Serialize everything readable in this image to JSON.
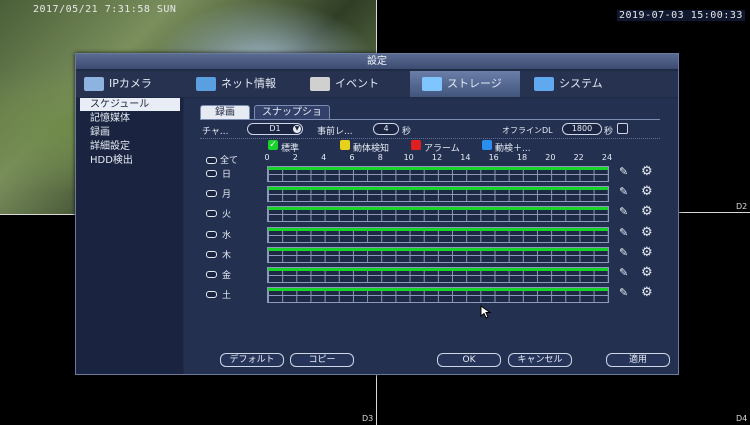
{
  "cameras": {
    "top_left_timestamp": "2017/05/21 7:31:58 SUN",
    "top_right_timestamp": "2019-07-03 15:00:33",
    "labels": [
      "D2",
      "D3",
      "D4"
    ]
  },
  "dialog": {
    "title": "設定",
    "main_tabs": [
      {
        "label": "IPカメラ",
        "icon": "ip-camera-icon",
        "color": "#8fb3e0"
      },
      {
        "label": "ネット情報",
        "icon": "network-icon",
        "color": "#5aa0e0"
      },
      {
        "label": "イベント",
        "icon": "event-icon",
        "color": "#d0d0d0"
      },
      {
        "label": "ストレージ",
        "icon": "storage-icon",
        "color": "#7fc6ff"
      },
      {
        "label": "システム",
        "icon": "system-icon",
        "color": "#60a8f0"
      }
    ],
    "active_main_tab": "ストレージ",
    "sidebar": [
      "スケジュール",
      "記憶媒体",
      "録画",
      "詳細設定",
      "HDD検出"
    ],
    "active_sidebar_item": "スケジュール",
    "sub_tabs": [
      "録画",
      "スナップショ"
    ],
    "active_sub_tab": "録画",
    "channel_label": "チャ...",
    "channel_value": "D1",
    "pre_record_label": "事前レ...",
    "pre_record_value": "4",
    "pre_record_unit": "秒",
    "offline_label": "オフラインDL",
    "offline_value": "1800",
    "offline_unit": "秒",
    "legend": [
      {
        "label": "標準",
        "color": "#18d32a"
      },
      {
        "label": "動体検知",
        "color": "#e6d21a"
      },
      {
        "label": "アラーム",
        "color": "#e02020"
      },
      {
        "label": "動検＋...",
        "color": "#2a8ff0"
      }
    ],
    "all_label": "全て",
    "hours": [
      "0",
      "2",
      "4",
      "6",
      "8",
      "10",
      "12",
      "14",
      "16",
      "18",
      "20",
      "22",
      "24"
    ],
    "days": [
      "日",
      "月",
      "火",
      "水",
      "木",
      "金",
      "土"
    ],
    "day_schedule_fraction": [
      1,
      1,
      1,
      1,
      1,
      1,
      1
    ],
    "schedule_color": "#18d32a",
    "buttons": {
      "default": "デフォルト",
      "copy": "コピー",
      "ok": "OK",
      "cancel": "キャンセル",
      "apply": "適用"
    }
  }
}
